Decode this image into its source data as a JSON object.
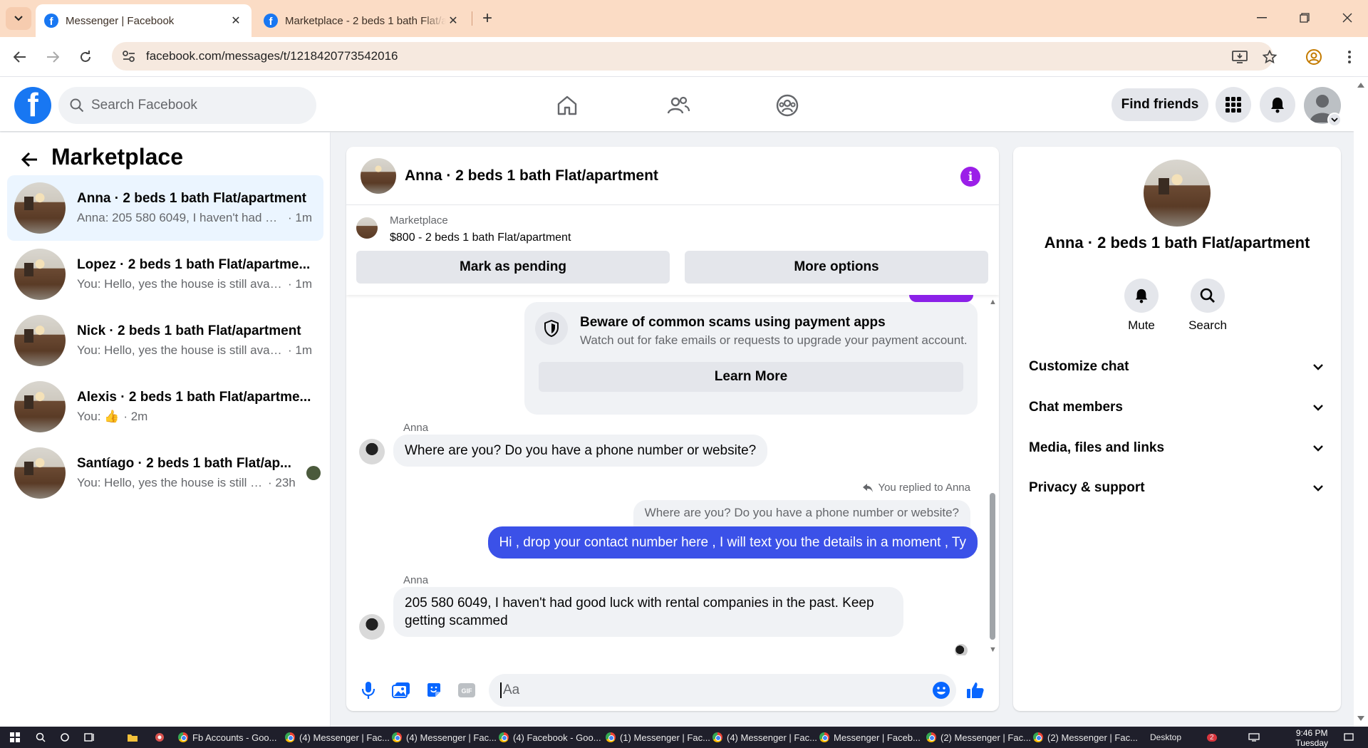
{
  "browser": {
    "tabs": [
      {
        "title": "Messenger | Facebook",
        "active": true
      },
      {
        "title": "Marketplace - 2 beds 1 bath Flat/apartment",
        "active": false
      }
    ],
    "url": "facebook.com/messages/t/1218420773542016"
  },
  "header": {
    "logo": "f",
    "search_placeholder": "Search Facebook",
    "find_friends": "Find friends"
  },
  "sidebar": {
    "title": "Marketplace",
    "conversations": [
      {
        "name": "Anna · 2 beds 1 bath Flat/apartment",
        "preview": "Anna: 205 580 6049, I haven't had go...",
        "time": "· 1m"
      },
      {
        "name": "Lopez · 2 beds 1 bath Flat/apartme...",
        "preview": "You: Hello, yes the house is still availa...",
        "time": "· 1m"
      },
      {
        "name": "Nick · 2 beds 1 bath Flat/apartment",
        "preview": "You: Hello, yes the house is still availa...",
        "time": "· 1m"
      },
      {
        "name": "Alexis · 2 beds 1 bath Flat/apartme...",
        "preview": "You: 👍",
        "time": "· 2m"
      },
      {
        "name": "Santíago · 2 beds 1 bath Flat/ap...",
        "preview": "You: Hello, yes the house is still av...",
        "time": "· 23h"
      }
    ]
  },
  "chat": {
    "title": "Anna · 2 beds 1 bath Flat/apartment",
    "marketplace_label": "Marketplace",
    "listing": "$800 - 2 beds 1 bath Flat/apartment",
    "mark_pending": "Mark as pending",
    "more_options": "More options",
    "scam_title": "Beware of common scams using payment apps",
    "scam_body": "Watch out for fake emails or requests to upgrade your payment account.",
    "learn_more": "Learn More",
    "sender": "Anna",
    "msg1": "Where are you? Do you have a phone number or website?",
    "replied_label": "You replied to Anna",
    "quoted": "Where are you? Do you have a phone number or website?",
    "my_msg": "Hi , drop your contact number here , I will text you the details in a moment , Ty",
    "msg2": "205 580 6049, I haven't had good luck with rental companies in the past. Keep getting scammed",
    "composer_placeholder": "Aa",
    "gif_label": "GIF"
  },
  "details": {
    "name": "Anna · 2 beds 1 bath Flat/apartment",
    "mute": "Mute",
    "search": "Search",
    "sections": [
      "Customize chat",
      "Chat members",
      "Media, files and links",
      "Privacy & support"
    ]
  },
  "taskbar": {
    "items": [
      "Fb Accounts - Goo...",
      "(4) Messenger | Fac...",
      "(4) Messenger | Fac...",
      "(4) Facebook - Goo...",
      "(1) Messenger | Fac...",
      "(4) Messenger | Fac...",
      "Messenger | Faceb...",
      "(2) Messenger | Fac...",
      "(2) Messenger | Fac..."
    ],
    "desktop": "Desktop",
    "time": "9:46 PM",
    "day": "Tuesday",
    "badge": "2"
  },
  "colors": {
    "brand": "#1877f2",
    "my_bubble": "#3b51e8",
    "info": "#9b1fe8",
    "tabbar": "#fbdcc5"
  }
}
